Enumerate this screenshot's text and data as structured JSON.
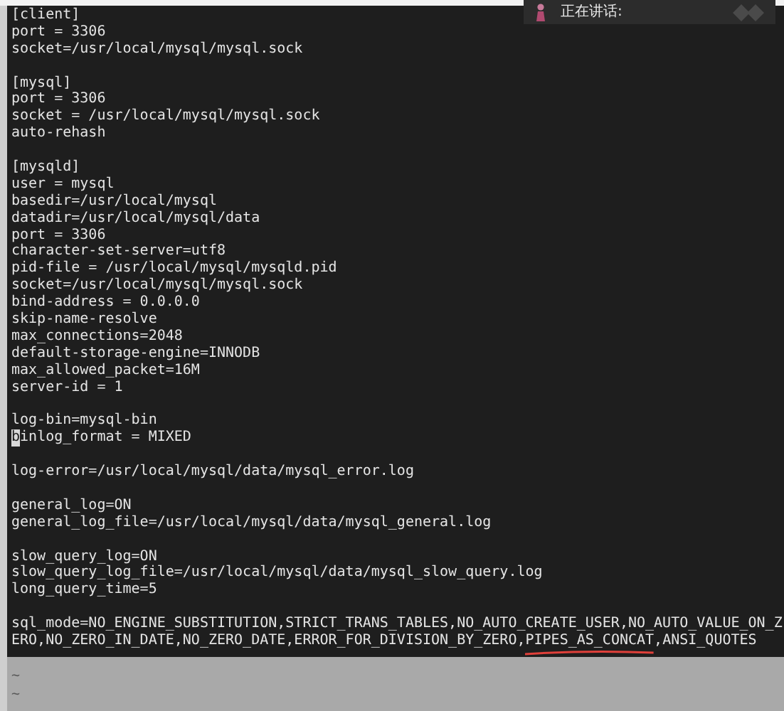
{
  "terminal": {
    "lines": [
      {
        "text": "[client]"
      },
      {
        "text": "port = 3306"
      },
      {
        "text": "socket=/usr/local/mysql/mysql.sock"
      },
      {
        "kind": "blank"
      },
      {
        "text": "[mysql]"
      },
      {
        "text": "port = 3306"
      },
      {
        "text": "socket = /usr/local/mysql/mysql.sock"
      },
      {
        "text": "auto-rehash"
      },
      {
        "kind": "blank"
      },
      {
        "text": "[mysqld]"
      },
      {
        "text": "user = mysql"
      },
      {
        "text": "basedir=/usr/local/mysql"
      },
      {
        "text": "datadir=/usr/local/mysql/data"
      },
      {
        "text": "port = 3306"
      },
      {
        "text": "character-set-server=utf8"
      },
      {
        "text": "pid-file = /usr/local/mysql/mysqld.pid"
      },
      {
        "text": "socket=/usr/local/mysql/mysql.sock"
      },
      {
        "text": "bind-address = 0.0.0.0"
      },
      {
        "text": "skip-name-resolve"
      },
      {
        "text": "max_connections=2048"
      },
      {
        "text": "default-storage-engine=INNODB"
      },
      {
        "text": "max_allowed_packet=16M"
      },
      {
        "text": "server-id = 1"
      },
      {
        "kind": "blank"
      },
      {
        "text": "log-bin=mysql-bin"
      },
      {
        "kind": "cursor",
        "cursor": "b",
        "text": "inlog_format = MIXED"
      },
      {
        "kind": "blank"
      },
      {
        "text": "log-error=/usr/local/mysql/data/mysql_error.log"
      },
      {
        "kind": "blank"
      },
      {
        "text": "general_log=ON"
      },
      {
        "text": "general_log_file=/usr/local/mysql/data/mysql_general.log"
      },
      {
        "kind": "blank"
      },
      {
        "text": "slow_query_log=ON"
      },
      {
        "text": "slow_query_log_file=/usr/local/mysql/data/mysql_slow_query.log"
      },
      {
        "text": "long_query_time=5"
      },
      {
        "kind": "blank"
      },
      {
        "text": "sql_mode=NO_ENGINE_SUBSTITUTION,STRICT_TRANS_TABLES,NO_AUTO_CREATE_USER,NO_AUTO_VALUE_ON_Z"
      },
      {
        "kind": "underlined",
        "before": "ERO,NO_ZERO_IN_DATE,NO_ZERO_DATE,ERROR_FOR_DIVISION_BY_ZERO,",
        "marked": "PIPES_AS_CONCAT",
        "after": ",ANSI_QUOTES"
      }
    ],
    "empty_lines": [
      "~",
      "~"
    ]
  },
  "speaking_overlay": {
    "label": "正在讲话:"
  }
}
